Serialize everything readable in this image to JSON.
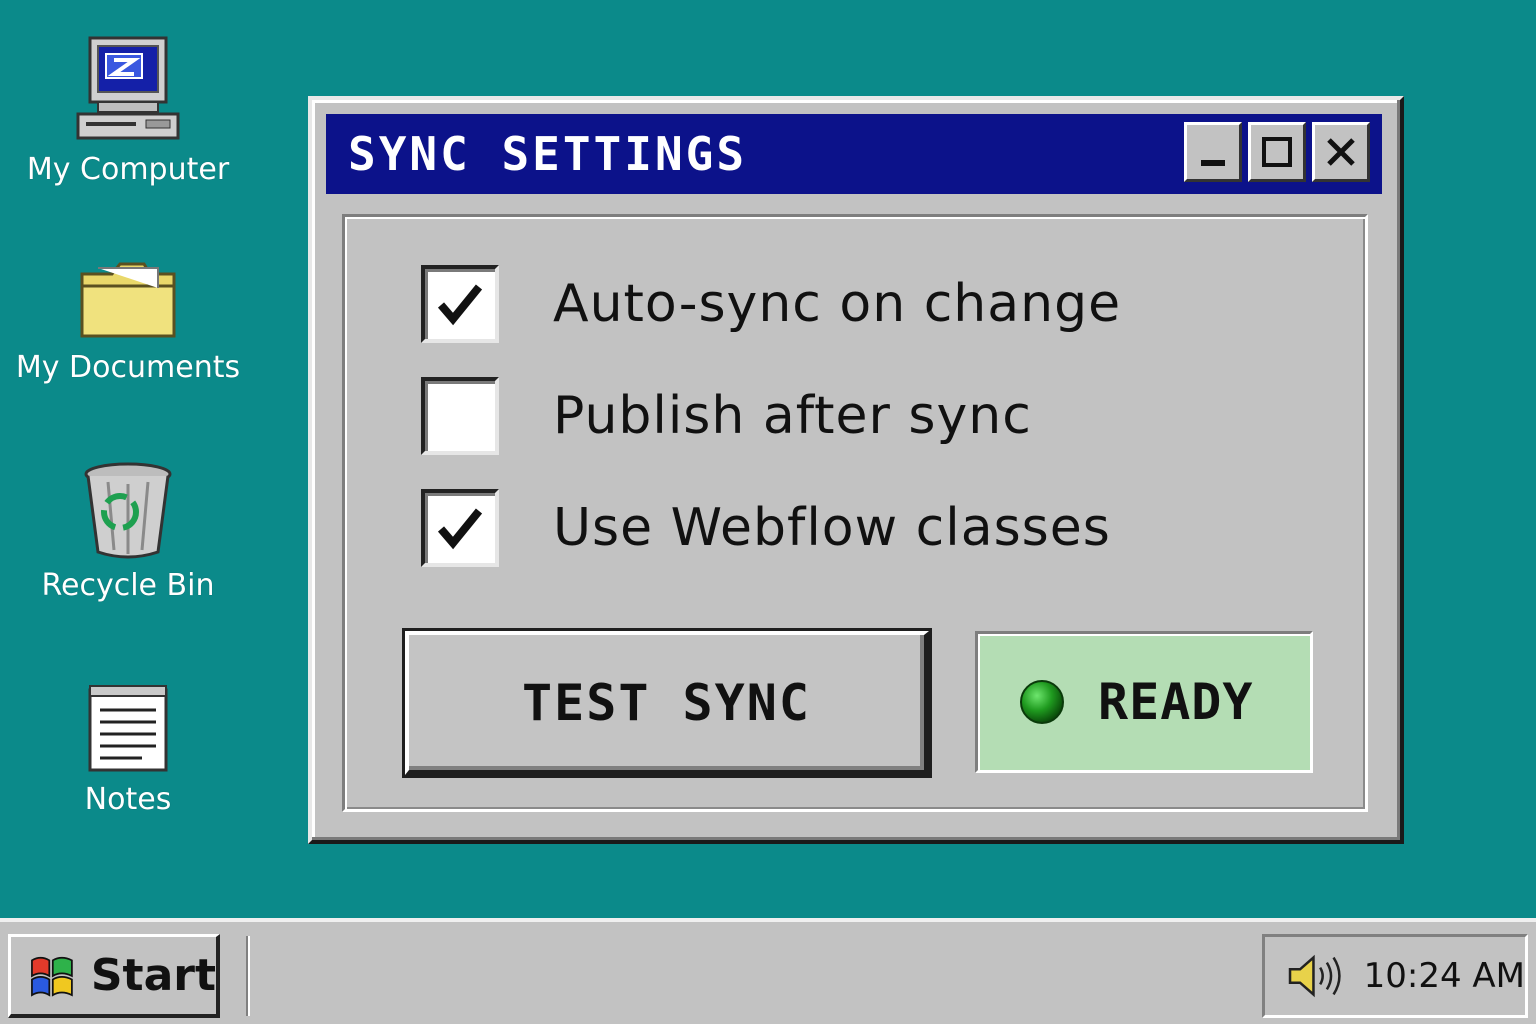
{
  "desktop": {
    "background_color": "#0b8a8a",
    "icons": [
      {
        "label": "My Computer",
        "icon": "computer-icon"
      },
      {
        "label": "My Documents",
        "icon": "folder-icon"
      },
      {
        "label": "Recycle Bin",
        "icon": "recycle-bin-icon"
      },
      {
        "label": "Notes",
        "icon": "notepad-icon"
      }
    ]
  },
  "window": {
    "title": "SYNC SETTINGS",
    "title_bar_color": "#0c128a",
    "controls": {
      "minimize": "minimize-icon",
      "maximize": "maximize-icon",
      "close": "close-icon"
    },
    "options": [
      {
        "label": "Auto-sync on change",
        "checked": true
      },
      {
        "label": "Publish after sync",
        "checked": false
      },
      {
        "label": "Use Webflow classes",
        "checked": true
      }
    ],
    "test_button_label": "TEST SYNC",
    "status": {
      "text": "READY",
      "indicator_color": "#1f9a1f",
      "background": "#b4ddb4"
    }
  },
  "taskbar": {
    "start_label": "Start",
    "tray": {
      "volume_icon": "speaker-icon",
      "clock": "10:24 AM"
    }
  }
}
